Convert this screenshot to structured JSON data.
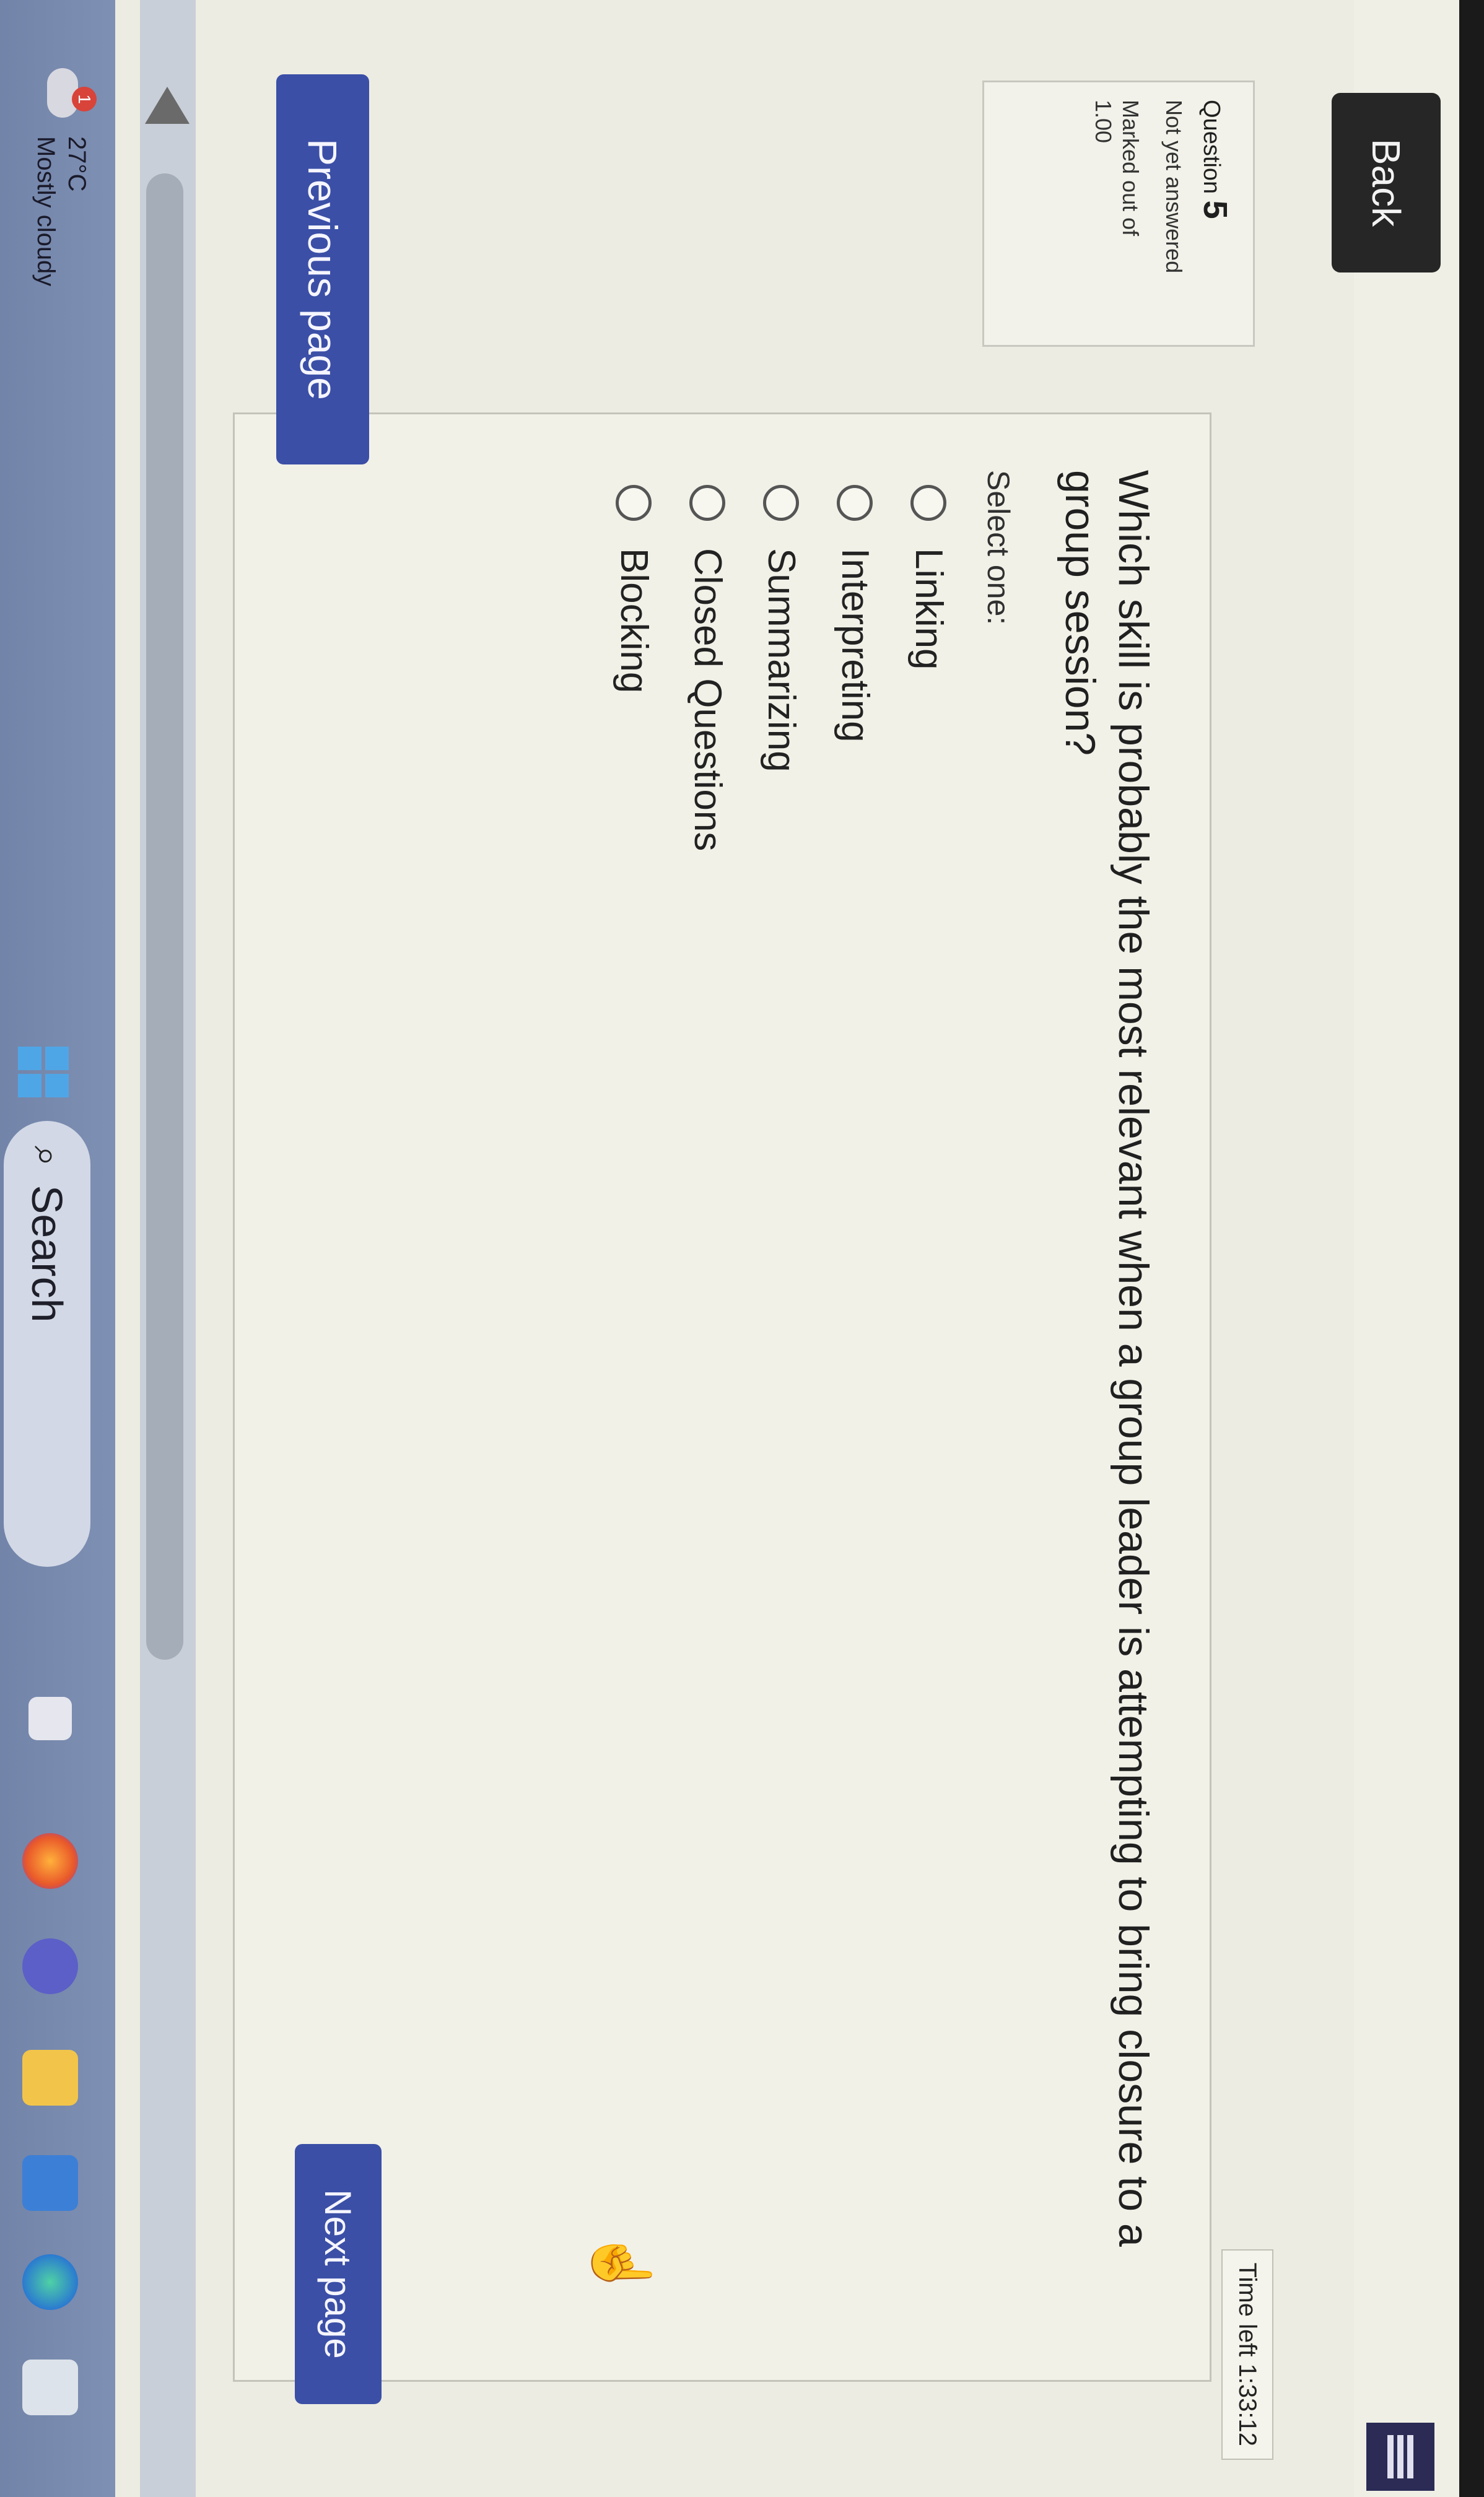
{
  "topbar": {
    "back_label": "Back"
  },
  "question_info": {
    "question_label": "Question",
    "question_number": "5",
    "status": "Not yet answered",
    "marked_label": "Marked out of",
    "marked_value": "1.00"
  },
  "timer": {
    "text": "Time left 1:33:12"
  },
  "question": {
    "text": "Which skill is probably the most relevant when a group leader is attempting to bring closure to a group session?",
    "select_label": "Select one:",
    "options": [
      "Linking",
      "Interpreting",
      "Summarizing",
      "Closed Questions",
      "Blocking"
    ]
  },
  "navigation": {
    "previous_label": "Previous page",
    "next_label": "Next page"
  },
  "taskbar": {
    "weather_badge": "1",
    "weather_temp": "27°C",
    "weather_desc": "Mostly cloudy",
    "search_label": "Search",
    "icons": [
      "task-view-icon",
      "firefox-icon",
      "teams-icon",
      "file-explorer-icon",
      "store-icon",
      "edge-icon",
      "keyboard-icon"
    ]
  },
  "colors": {
    "button_primary": "#3b4fa6",
    "back_button": "#262626",
    "taskbar": "#7e90b3"
  }
}
